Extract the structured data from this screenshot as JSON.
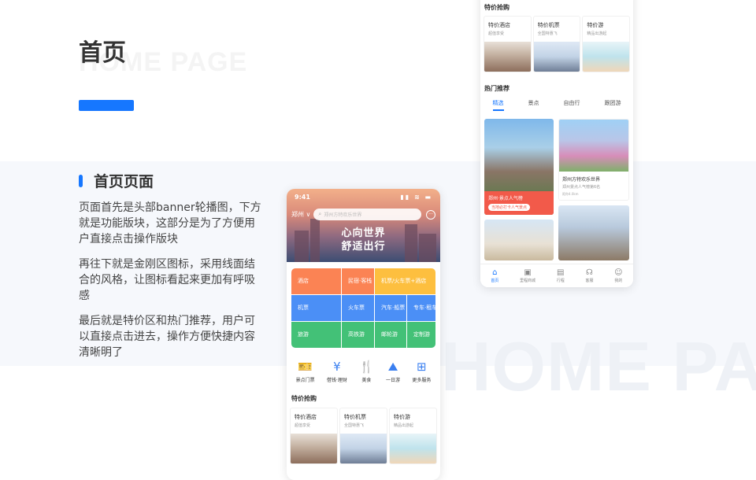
{
  "watermark_top": "HOME PAGE",
  "watermark_big": "HOME PA",
  "page_title": "首页",
  "section_title": "首页页面",
  "paragraphs": [
    "页面首先是头部banner轮播图，下方就是功能版块，这部分是为了方便用户直接点击操作版块",
    "再往下就是金刚区图标，采用线面结合的风格，让图标看起来更加有呼吸感",
    "最后就是特价区和热门推荐，用户可以直接点击进去，操作方便快捷内容清晰明了"
  ],
  "phone_main": {
    "status_time": "9:41",
    "status_icons": "▮▮ ≋ ▬",
    "city": "郑州 ∨",
    "search_placeholder": "郑州方特欢乐世界",
    "banner_slogan_1": "心向世界",
    "banner_slogan_2": "舒适出行",
    "kingkong": [
      {
        "label": "酒店",
        "color": "orange"
      },
      {
        "label": "民宿·客栈",
        "color": "orange"
      },
      {
        "label": "机票/火车票+酒店",
        "color": "yellow"
      },
      {
        "label": "机票",
        "color": "blue"
      },
      {
        "label": "火车票",
        "color": "blue"
      },
      {
        "label": "汽车·船票",
        "color": "blue"
      },
      {
        "label": "专车·租车",
        "color": "blue"
      },
      {
        "label": "旅游",
        "color": "green"
      },
      {
        "label": "高铁游",
        "color": "green"
      },
      {
        "label": "邮轮游",
        "color": "green"
      },
      {
        "label": "定制游",
        "color": "green"
      }
    ],
    "icons": [
      {
        "label": "景点门票",
        "icon": "ticket-icon"
      },
      {
        "label": "借钱·理财",
        "icon": "money-bag-icon"
      },
      {
        "label": "美食",
        "icon": "food-icon"
      },
      {
        "label": "一日游",
        "icon": "mountain-icon"
      },
      {
        "label": "更多服务",
        "icon": "grid-icon"
      }
    ],
    "special_title": "特价抢购",
    "special": [
      {
        "title": "特价酒店",
        "sub": "超值享受"
      },
      {
        "title": "特价机票",
        "sub": "全国特惠飞"
      },
      {
        "title": "特价游",
        "sub": "精品出游起"
      }
    ]
  },
  "phone_right": {
    "special_title": "特价抢购",
    "special": [
      {
        "title": "特价酒店",
        "sub": "超值享受"
      },
      {
        "title": "特价机票",
        "sub": "全国特惠飞"
      },
      {
        "title": "特价游",
        "sub": "精品出游起"
      }
    ],
    "hot_title": "热门推荐",
    "tabs": [
      "精选",
      "景点",
      "自由行",
      "跟团游"
    ],
    "tile1_label": "郑州·景点人气榜",
    "tile1_pill": "当地必打卡人气景点",
    "tile2_title": "郑州方特欢乐世界",
    "tile2_sub": "郑州景点人气榜第6名",
    "tile2_sub2": "距你4.0km",
    "tabbar": [
      {
        "label": "首页",
        "icon": "home-icon",
        "active": true
      },
      {
        "label": "里程商城",
        "icon": "mall-icon",
        "active": false
      },
      {
        "label": "行程",
        "icon": "calendar-icon",
        "active": false
      },
      {
        "label": "客服",
        "icon": "service-icon",
        "active": false
      },
      {
        "label": "我的",
        "icon": "user-icon",
        "active": false
      }
    ]
  }
}
